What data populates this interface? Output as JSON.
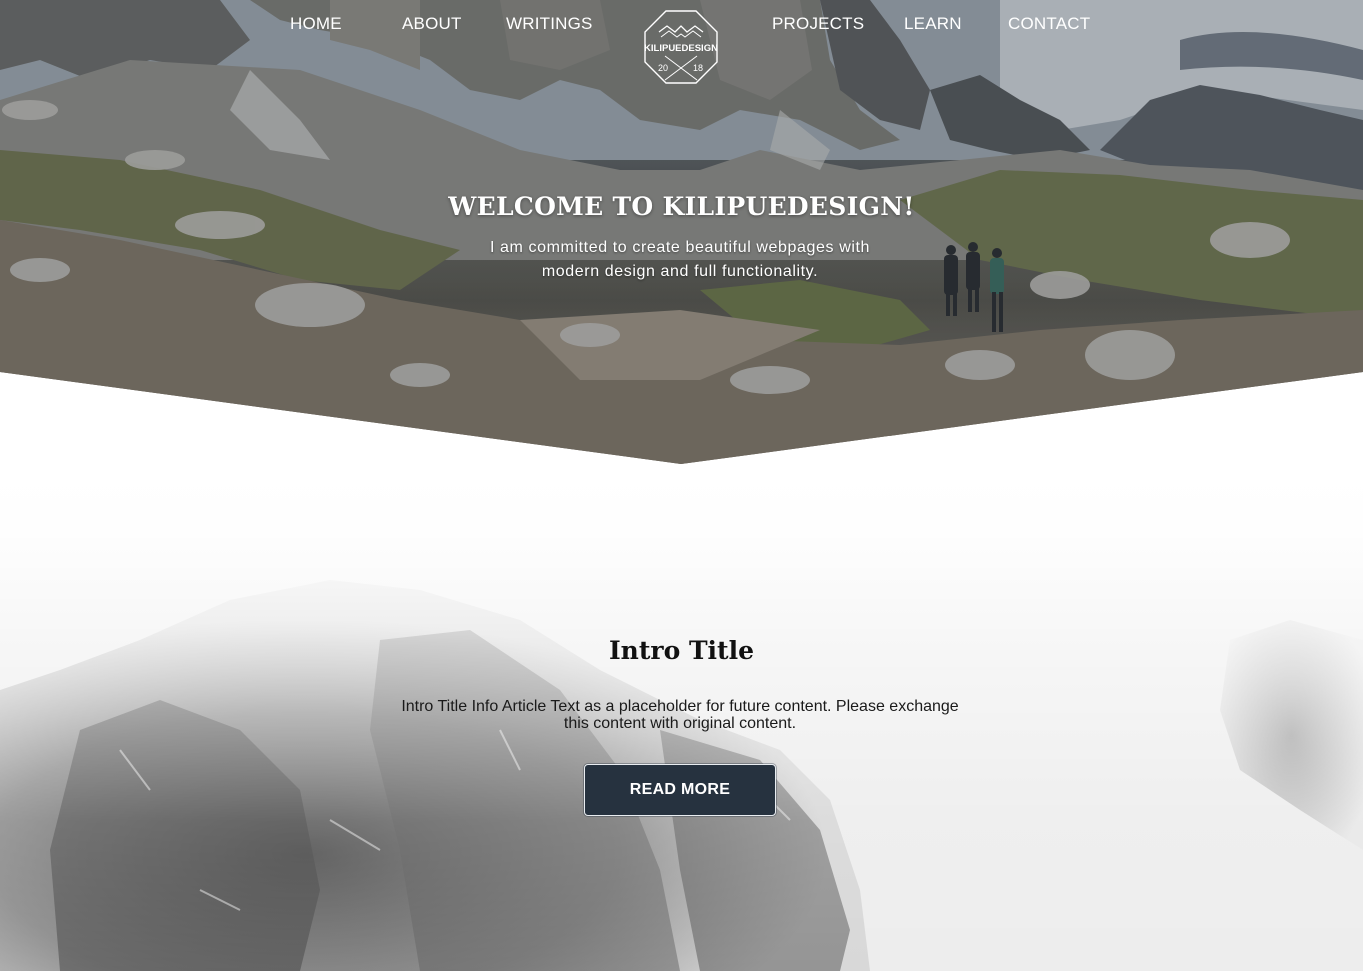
{
  "nav": {
    "left_items": [
      {
        "label": "HOME"
      },
      {
        "label": "ABOUT"
      },
      {
        "label": "WRITINGS"
      }
    ],
    "right_items": [
      {
        "label": "PROJECTS"
      },
      {
        "label": "LEARN"
      },
      {
        "label": "CONTACT"
      }
    ],
    "logo": {
      "name": "KILIPUEDESIGN",
      "year_left": "20",
      "year_right": "18"
    }
  },
  "hero": {
    "title": "WELCOME TO KILIPUEDESIGN!",
    "subtitle": "I am committed to create beautiful webpages with modern design and full functionality."
  },
  "intro": {
    "title": "Intro Title",
    "text": "Intro Title Info Article Text as a placeholder for future content. Please exchange this content with original content.",
    "button_label": "READ MORE"
  },
  "colors": {
    "button_bg": "#26323f",
    "nav_text": "#ffffff",
    "hero_text": "#ffffff",
    "intro_text": "#111111"
  },
  "icons": {
    "logo": "octagon-mountain-logo-icon"
  }
}
